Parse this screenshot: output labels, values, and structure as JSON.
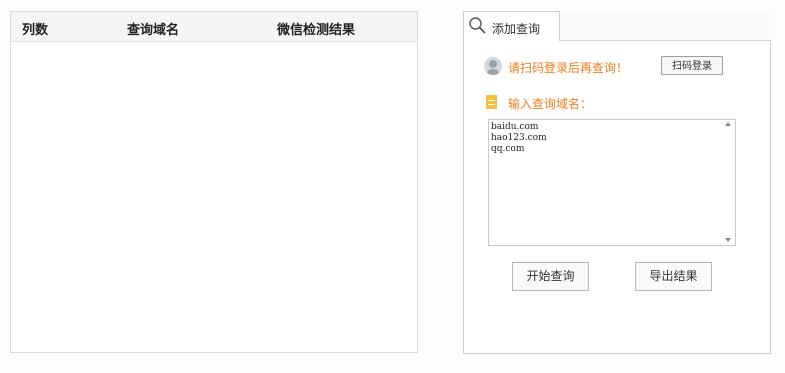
{
  "results_table": {
    "columns": [
      "列数",
      "查询域名",
      "微信检测结果"
    ]
  },
  "query_tab": {
    "label": "添加查询",
    "icon": "search-icon"
  },
  "query_panel": {
    "login_hint": "请扫码登录后再查询！",
    "scan_login_button": "扫码登录",
    "domain_input_label": "输入查询域名：",
    "domains": [
      "baidu.com",
      "hao123.com",
      "qq.com"
    ],
    "start_button": "开始查询",
    "export_button": "导出结果"
  },
  "colors": {
    "accent_orange": "#f07f1f",
    "doc_icon_yellow": "#f6c044",
    "border": "#cfcfcf"
  }
}
